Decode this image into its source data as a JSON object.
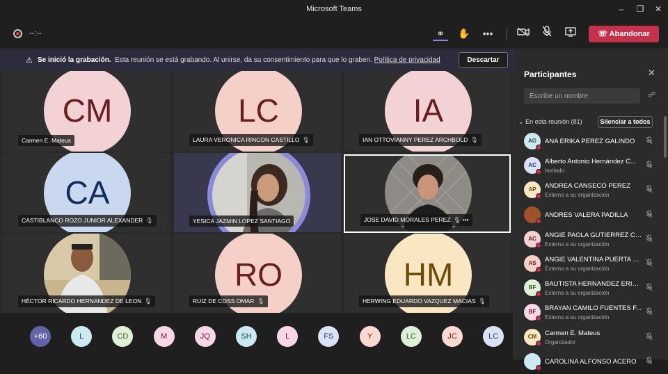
{
  "window": {
    "title": "Microsoft Teams"
  },
  "toolbar": {
    "timer": "--:--",
    "leave_label": "Abandonar"
  },
  "banner": {
    "bold": "Se inició la grabación.",
    "text": "Esta reunión se está grabando. Al unirse, da su consentimiento para que lo graben.",
    "link": "Política de privacidad",
    "dismiss": "Descartar"
  },
  "tiles": [
    {
      "initials": "CM",
      "name": "Carmen E. Mateus",
      "color": "#f2d2d4"
    },
    {
      "initials": "LC",
      "name": "LAURA VERONICA RINCON CASTILLO",
      "color": "#f4d0c8"
    },
    {
      "initials": "IA",
      "name": "IAN OTTOVIANNY PEREZ ARCHBOLD",
      "color": "#f2d2d4"
    },
    {
      "initials": "CA",
      "name": "CASTIBLANCO ROZO JUNIOR ALEXANDER",
      "color": "#c9d8ee"
    },
    {
      "initials": "",
      "name": "YESICA JAZMIN LOPEZ SANTIAGO"
    },
    {
      "initials": "",
      "name": "JOSE DAVID MORALES PEREZ"
    },
    {
      "initials": "",
      "name": "HÉCTOR RICARDO HERNANDEZ DE LEON"
    },
    {
      "initials": "RO",
      "name": "RUIZ DE COSS OMAR",
      "color": "#f4d0c8"
    },
    {
      "initials": "HM",
      "name": "HERWING EDUARDO VAZQUEZ MACIAS",
      "color": "#f8e7c2"
    }
  ],
  "overflow": [
    {
      "label": "+60",
      "color": "#6264a7",
      "text": "#ffffff"
    },
    {
      "label": "L",
      "color": "#cde9f1",
      "text": "#2a4a55"
    },
    {
      "label": "CD",
      "color": "#dff0d8",
      "text": "#3b5a2b"
    },
    {
      "label": "M",
      "color": "#f7d6e6",
      "text": "#6a2046"
    },
    {
      "label": "JQ",
      "color": "#f7d6e6",
      "text": "#6a2046"
    },
    {
      "label": "SH",
      "color": "#cde9f1",
      "text": "#2a4a55"
    },
    {
      "label": "L",
      "color": "#f7d6e6",
      "text": "#6a2046"
    },
    {
      "label": "FS",
      "color": "#d9e3f5",
      "text": "#253d6b"
    },
    {
      "label": "Y",
      "color": "#fbd9d3",
      "text": "#6a2421"
    },
    {
      "label": "LC",
      "color": "#dff0d8",
      "text": "#3b5a2b"
    },
    {
      "label": "JC",
      "color": "#fbd9d3",
      "text": "#6a2421"
    },
    {
      "label": "LC",
      "color": "#d9e3f5",
      "text": "#253d6b"
    }
  ],
  "panel": {
    "title": "Participantes",
    "search_placeholder": "Escribe un nombre",
    "section": "En esta reunión (81)",
    "mute_all": "Silenciar a todos",
    "participants": [
      {
        "initials": "AG",
        "name": "ANA ERIKA PEREZ GALINDO",
        "sub": "",
        "color": "#cde9f1",
        "text": "#2a4a55"
      },
      {
        "initials": "AC",
        "name": "Alberto Antonio Hernández C...",
        "sub": "Invitado",
        "color": "#d9e3f5",
        "text": "#253d6b"
      },
      {
        "initials": "AP",
        "name": "ANDREA CANSECO PEREZ",
        "sub": "Externo a su organización",
        "color": "#f8e7c2",
        "text": "#6b4a0a"
      },
      {
        "initials": "",
        "name": "ANDRES VALERA PADILLA",
        "sub": "",
        "color": "#a0522d",
        "text": "#ffffff"
      },
      {
        "initials": "AC",
        "name": "ANGIE PAOLA GUTIERREZ CA...",
        "sub": "Externo a su organización",
        "color": "#f2d2d4",
        "text": "#6a1d1f"
      },
      {
        "initials": "AS",
        "name": "ANGIE VALENTINA PUERTA S...",
        "sub": "Externo a su organización",
        "color": "#f4d0c8",
        "text": "#6a1d1f"
      },
      {
        "initials": "BF",
        "name": "BAUTISTA HERNANDEZ ERIKC...",
        "sub": "Externo a su organización",
        "color": "#dff0d8",
        "text": "#3b5a2b"
      },
      {
        "initials": "BF",
        "name": "BRAYAN CAMILO FUENTES F...",
        "sub": "Externo a su organización",
        "color": "#f7d6e6",
        "text": "#6a2046"
      },
      {
        "initials": "CM",
        "name": "Carmen E. Mateus",
        "sub": "Organizador",
        "color": "#f8e7c2",
        "text": "#6b4a0a"
      },
      {
        "initials": "",
        "name": "CAROLINA ALFONSO ACERO",
        "sub": "",
        "color": "#cde9f1",
        "text": "#2a4a55"
      }
    ]
  }
}
